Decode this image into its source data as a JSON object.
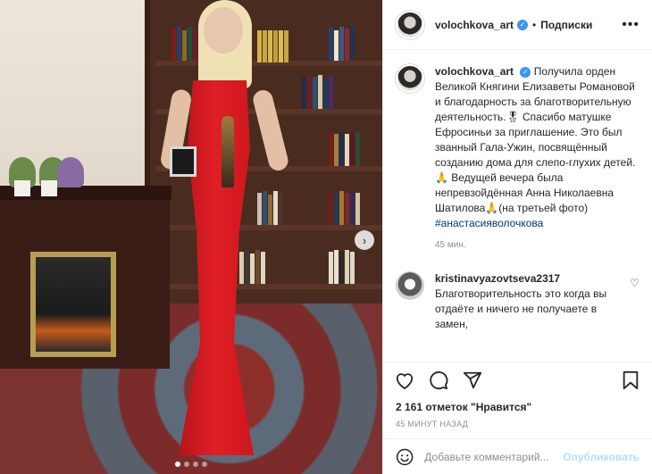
{
  "post": {
    "username": "volochkova_art",
    "follow_state": "Подписки",
    "separator": "•",
    "caption": "Получила орден Великой Княгини Елизаветы Романовой и благодарность за благотворительную деятельность.🎖 Спасибо матушке Ефросиньи за приглашение. Это был званный Гала-Ужин, посвящённый созданию дома для слепо-глухих детей.🙏 Ведущей вечера была непревзойдённая Анна Николаевна Шатилова🙏(на третьей фото)",
    "hashtag": "#анастасияволочкова",
    "caption_age": "45 мин.",
    "likes": "2 161 отметок \"Нравится\"",
    "timestamp": "45 минут назад"
  },
  "comments": [
    {
      "username": "kristinavyazovtseva2317",
      "text": "Благотворительность это когда вы отдаёте и ничего не получаете в замен,"
    }
  ],
  "add_comment": {
    "placeholder": "Добавьте комментарий...",
    "publish_label": "Опубликовать"
  },
  "media": {
    "carousel_total": 4,
    "carousel_active": 1
  },
  "icons": {
    "verified": "verified-badge-icon",
    "more": "more-options-icon",
    "like": "heart-icon",
    "comment": "comment-bubble-icon",
    "share": "paper-plane-icon",
    "save": "bookmark-icon",
    "emoji": "smiley-icon",
    "next": "chevron-right-icon"
  },
  "colors": {
    "verified_blue": "#3897f0",
    "hashtag": "#00376b",
    "muted_text": "#8e8e8e",
    "publish_disabled": "#b2dffc",
    "dress_red": "#e01f25"
  }
}
